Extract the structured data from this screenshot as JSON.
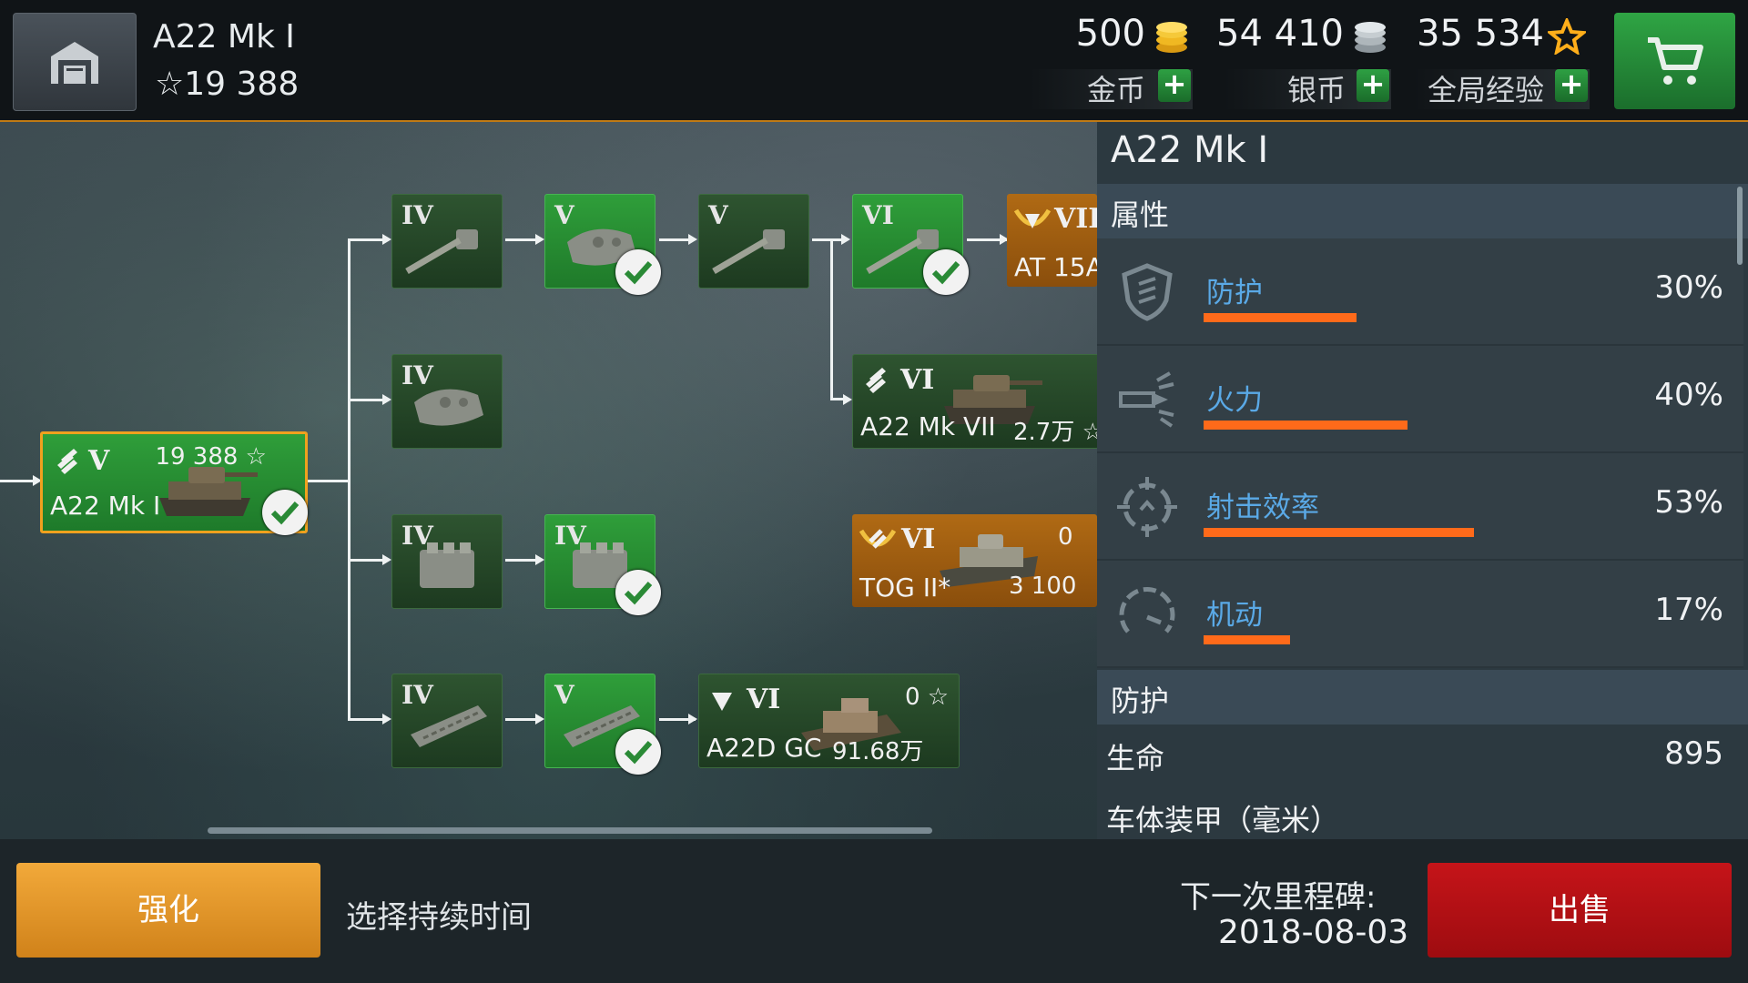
{
  "header": {
    "tank_name": "A22 Mk I",
    "tank_xp": "☆19 388",
    "gold_amount": "500",
    "gold_label": "金币",
    "silver_amount": "54 410",
    "silver_label": "银币",
    "freexp_amount": "35 534",
    "freexp_label": "全局经验",
    "plus": "+"
  },
  "tree": {
    "current": {
      "tier": "V",
      "name": "A22 Mk I",
      "xp": "19 388 ☆"
    },
    "modules": [
      {
        "tier": "IV",
        "icon": "gun-icon"
      },
      {
        "tier": "V",
        "icon": "turret-icon"
      },
      {
        "tier": "V",
        "icon": "gun-icon"
      },
      {
        "tier": "VI",
        "icon": "gun-icon"
      },
      {
        "tier": "IV",
        "icon": "turret-icon"
      },
      {
        "tier": "IV",
        "icon": "engine-icon"
      },
      {
        "tier": "IV",
        "icon": "engine-icon"
      },
      {
        "tier": "IV",
        "icon": "tracks-icon"
      },
      {
        "tier": "V",
        "icon": "tracks-icon"
      }
    ],
    "next_tanks": [
      {
        "tier": "VII",
        "name": "AT 15A"
      },
      {
        "tier": "VI",
        "name": "A22 Mk VII",
        "cost": "2.7万 ☆"
      },
      {
        "tier": "VI",
        "name": "TOG II*",
        "xp": "0",
        "cost": "3 100"
      },
      {
        "tier": "VI",
        "name": "A22D GC",
        "xp": "0 ☆",
        "cost": "91.68万"
      }
    ]
  },
  "panel": {
    "title": "A22 Mk I",
    "attributes_heading": "属性",
    "stats": [
      {
        "label": "防护",
        "value": "30%",
        "fill": 0.3
      },
      {
        "label": "火力",
        "value": "40%",
        "fill": 0.4
      },
      {
        "label": "射击效率",
        "value": "53%",
        "fill": 0.53
      },
      {
        "label": "机动",
        "value": "17%",
        "fill": 0.17
      }
    ],
    "protection_heading": "防护",
    "hp_label": "生命",
    "hp_value": "895",
    "armor_label": "车体装甲（毫米）"
  },
  "footer": {
    "upgrade_label": "强化",
    "duration_label": "选择持续时间",
    "milestone_label": "下一次里程碑:",
    "milestone_date": "2018-08-03",
    "sell_label": "出售"
  }
}
